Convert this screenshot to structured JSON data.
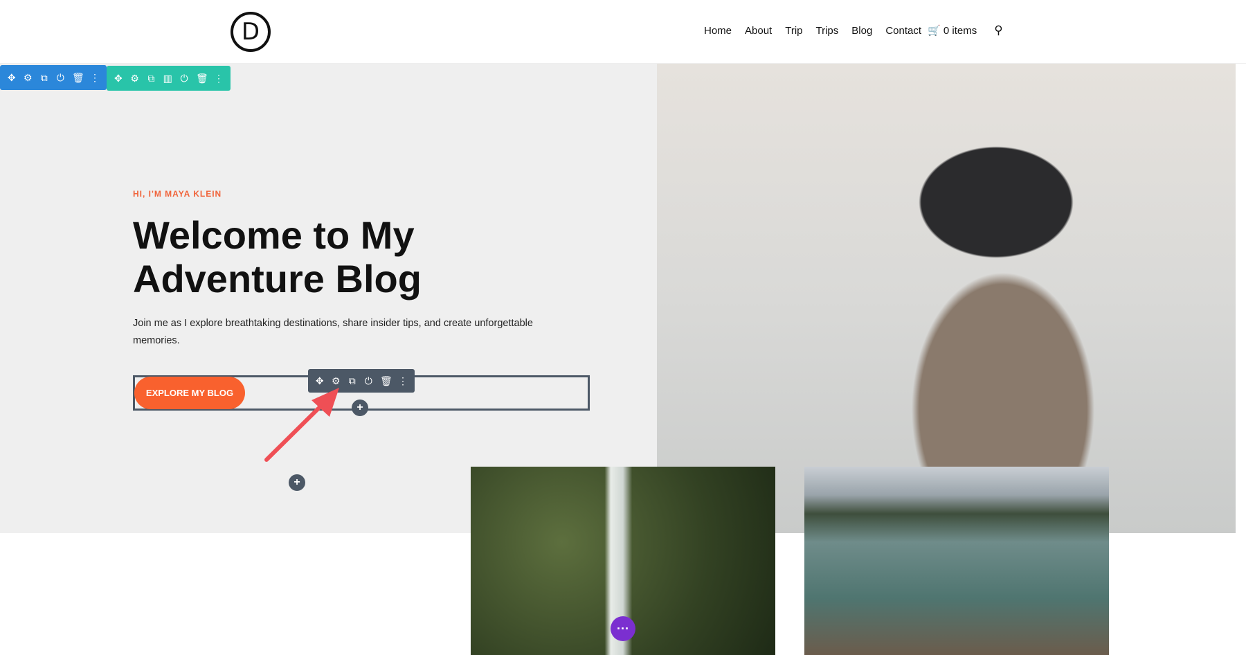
{
  "header": {
    "logo": "D",
    "nav": [
      "Home",
      "About",
      "Trip",
      "Trips",
      "Blog",
      "Contact"
    ],
    "cart": "0 items"
  },
  "toolbars": {
    "section": [
      "move-icon",
      "gear-icon",
      "duplicate-icon",
      "power-icon",
      "trash-icon",
      "more-icon"
    ],
    "row": [
      "move-icon",
      "gear-icon",
      "duplicate-icon",
      "columns-icon",
      "power-icon",
      "trash-icon",
      "more-icon"
    ],
    "module": [
      "move-icon",
      "gear-icon",
      "duplicate-icon",
      "power-icon",
      "trash-icon",
      "more-icon"
    ]
  },
  "hero": {
    "subtitle": "HI, I'M MAYA KLEIN",
    "title": "Welcome to My Adventure Blog",
    "paragraph": "Join me as I explore breathtaking destinations, share insider tips, and create unforgettable memories.",
    "button": "EXPLORE MY BLOG"
  },
  "colors": {
    "accent": "#f9612e",
    "section_toolbar": "#2b87da",
    "row_toolbar": "#29c4a9",
    "module_toolbar": "#4c5866",
    "annotation_arrow": "#ef4f55",
    "more_button": "#7b2fd0"
  }
}
